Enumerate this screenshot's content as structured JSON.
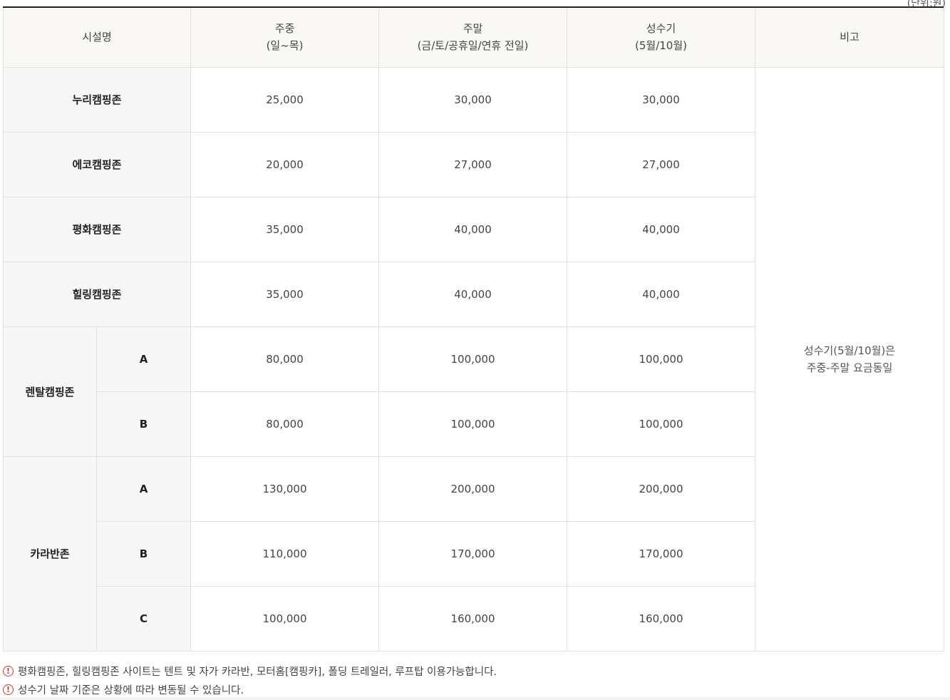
{
  "unit_stub": "(단위:원)",
  "header": {
    "facility": "시설명",
    "weekday": [
      "주중",
      "(일~목)"
    ],
    "weekend": [
      "주말",
      "(금/토/공휴일/연휴 전일)"
    ],
    "peak": [
      "성수기",
      "(5월/10월)"
    ],
    "remarks": "비고"
  },
  "rows": [
    {
      "name": "누리캠핑존",
      "weekday": "25,000",
      "weekend": "30,000",
      "peak": "30,000"
    },
    {
      "name": "에코캠핑존",
      "weekday": "20,000",
      "weekend": "27,000",
      "peak": "27,000"
    },
    {
      "name": "평화캠핑존",
      "weekday": "35,000",
      "weekend": "40,000",
      "peak": "40,000"
    },
    {
      "name": "힐링캠핑존",
      "weekday": "35,000",
      "weekend": "40,000",
      "peak": "40,000"
    }
  ],
  "rental": {
    "name": "렌탈캠핑존",
    "subs": [
      {
        "label": "A",
        "weekday": "80,000",
        "weekend": "100,000",
        "peak": "100,000"
      },
      {
        "label": "B",
        "weekday": "80,000",
        "weekend": "100,000",
        "peak": "100,000"
      }
    ]
  },
  "caravan": {
    "name": "카라반존",
    "subs": [
      {
        "label": "A",
        "weekday": "130,000",
        "weekend": "200,000",
        "peak": "200,000"
      },
      {
        "label": "B",
        "weekday": "110,000",
        "weekend": "170,000",
        "peak": "170,000"
      },
      {
        "label": "C",
        "weekday": "100,000",
        "weekend": "160,000",
        "peak": "160,000"
      }
    ]
  },
  "remark": [
    "성수기(5월/10월)은",
    "주중-주말 요금동일"
  ],
  "notes": [
    "평화캠핑존, 힐링캠핑존 사이트는 텐트 및 자가 카라반, 모터홈[캠핑카], 폴딩 트레일러, 루프탑 이용가능합니다.",
    "성수기 날짜 기준은 상황에 따라 변동될 수 있습니다."
  ],
  "colors": {
    "warning": "#d9322b",
    "header_bg": "#f9f8f4",
    "label_bg": "#f7f7f7"
  }
}
